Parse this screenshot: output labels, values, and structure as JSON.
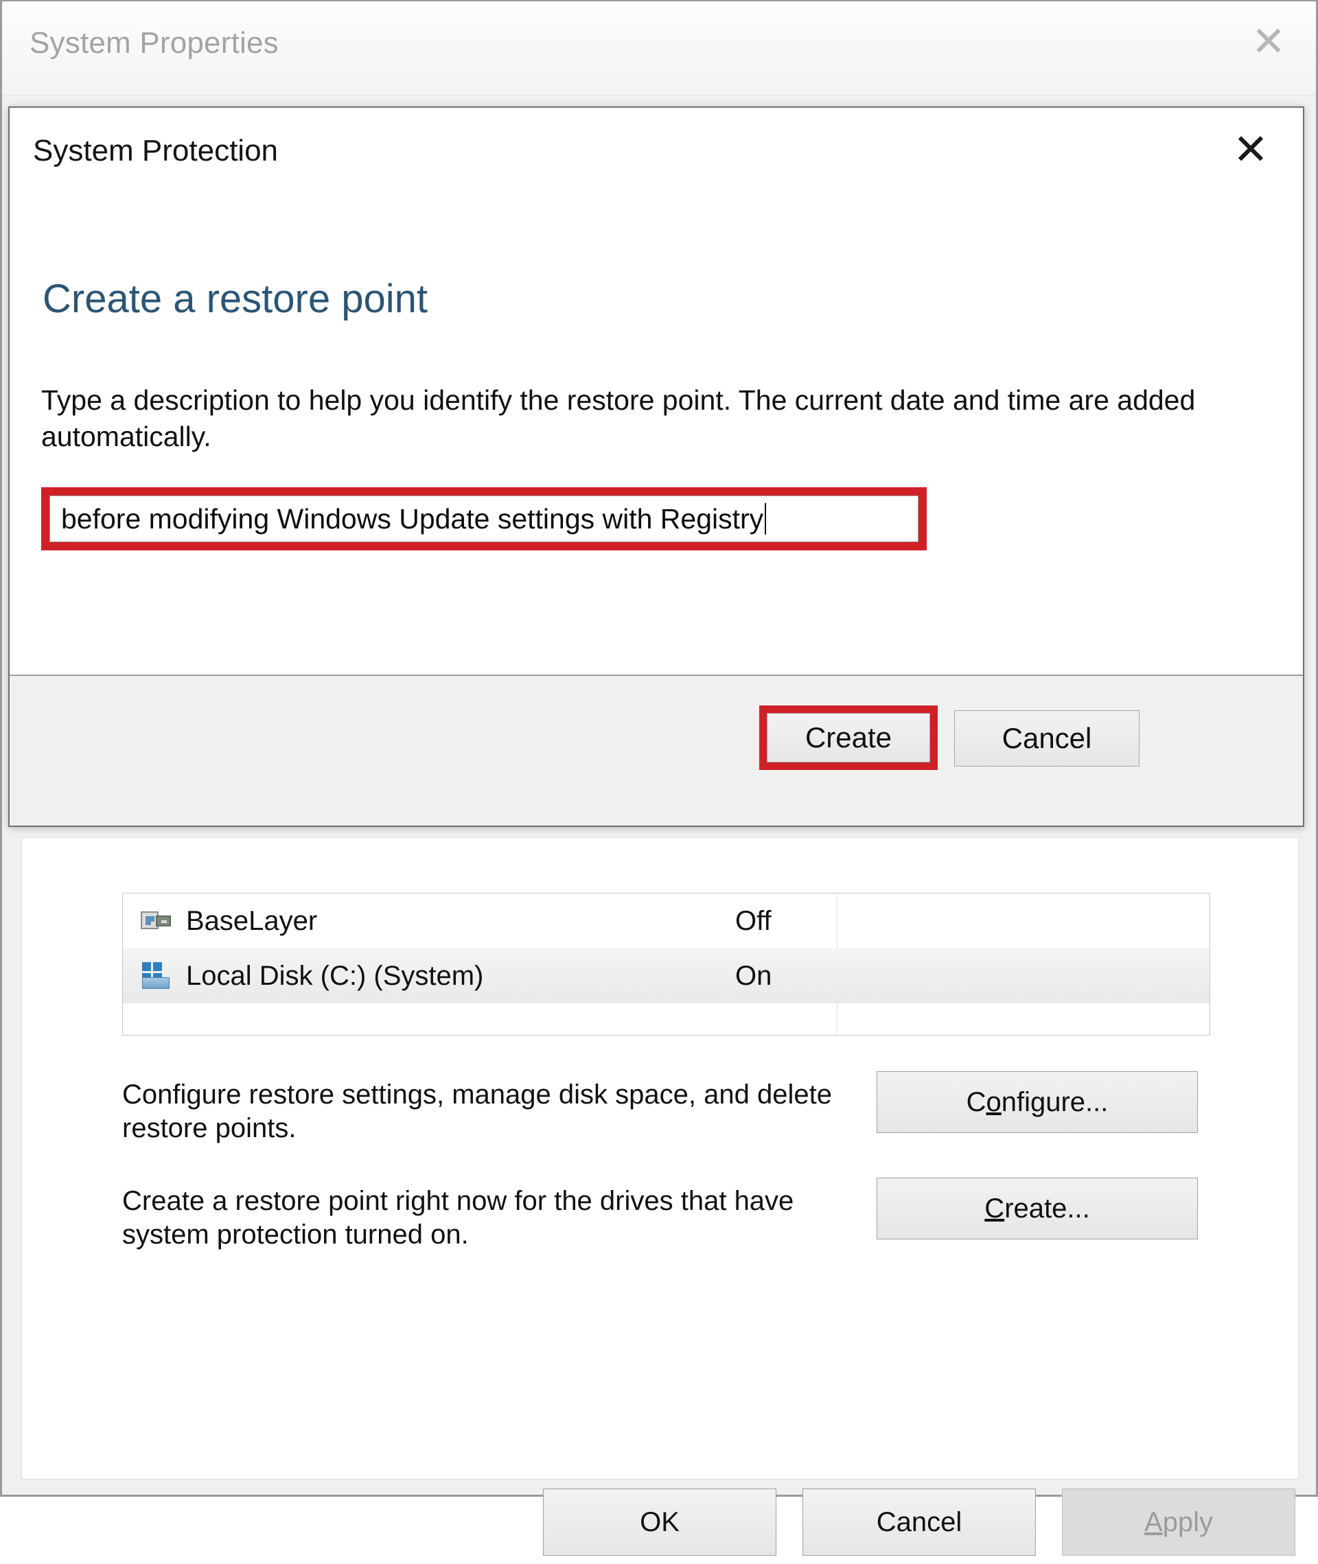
{
  "background_window": {
    "title": "System Properties",
    "close_icon": "close-icon",
    "drive_list": {
      "rows": [
        {
          "icon": "network-drive-icon",
          "name": "BaseLayer",
          "status": "Off",
          "selected": false
        },
        {
          "icon": "local-disk-icon",
          "name": "Local Disk (C:) (System)",
          "status": "On",
          "selected": true
        }
      ]
    },
    "configure_section": {
      "text": "Configure restore settings, manage disk space, and delete restore points.",
      "button_label": "Configure...",
      "button_accel": "o"
    },
    "create_section": {
      "text": "Create a restore point right now for the drives that have system protection turned on.",
      "button_label": "Create...",
      "button_accel": "C"
    },
    "footer_buttons": [
      {
        "label": "OK",
        "accel": "",
        "disabled": false
      },
      {
        "label": "Cancel",
        "accel": "",
        "disabled": false
      },
      {
        "label": "Apply",
        "accel": "A",
        "disabled": true
      }
    ]
  },
  "modal": {
    "title": "System Protection",
    "close_icon": "close-icon",
    "heading": "Create a restore point",
    "description": "Type a description to help you identify the restore point. The current date and time are added automatically.",
    "input": {
      "value": "before modifying Windows Update settings with Registry",
      "placeholder": ""
    },
    "buttons": {
      "create_label": "Create",
      "cancel_label": "Cancel"
    }
  },
  "annotations": {
    "highlight_color": "#cf2026",
    "targets": [
      "restore-point-input",
      "create-button"
    ]
  },
  "colors": {
    "heading_blue": "#2b5575",
    "inactive_title": "#a3a3a3",
    "annotation_red": "#cf2026",
    "window_chrome": "#f0f0f0"
  }
}
